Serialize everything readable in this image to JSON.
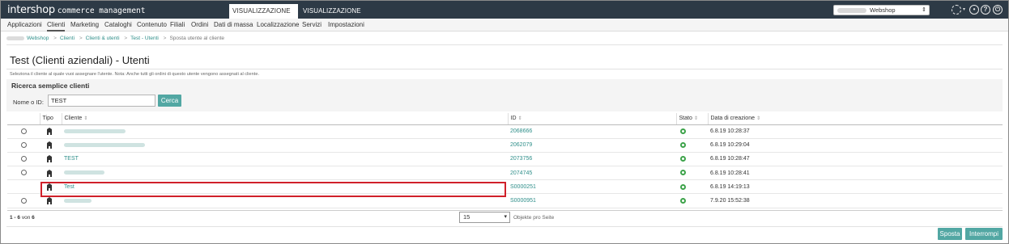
{
  "header": {
    "brand_main": "intershop",
    "brand_sub": "commerce management",
    "tab_data": "VISUALIZZAZIONE DATI",
    "tab_design": "VISUALIZZAZIONE DESIGN",
    "site_selector": "Webshop"
  },
  "nav": {
    "items": [
      "Applicazioni",
      "Clienti",
      "Marketing",
      "Cataloghi",
      "Contenuto",
      "Filiali",
      "Ordini",
      "Dati di massa",
      "Localizzazione",
      "Servizi",
      "Impostazioni"
    ],
    "active": "Clienti"
  },
  "breadcrumb": {
    "items": [
      "Webshop",
      "Clienti",
      "Clienti & utenti",
      "Test - Utenti",
      "Sposta utente al cliente"
    ]
  },
  "page": {
    "title": "Test (Clienti aziendali) - Utenti",
    "description": "Seleziona il cliente al quale vuoi assegnare l'utente. Nota: Anche tutti gli ordini di questo utente vengono assegnati al cliente."
  },
  "search": {
    "title": "Ricerca semplice clienti",
    "label": "Nome o ID:",
    "value": "TEST",
    "button": "Cerca"
  },
  "table": {
    "headers": {
      "type": "Tipo",
      "customer": "Cliente",
      "id": "ID",
      "status": "Stato",
      "created": "Data di creazione"
    },
    "rows": [
      {
        "name": "",
        "id": "2068666",
        "created": "6.8.19 10:28:37"
      },
      {
        "name": "",
        "id": "2062079",
        "created": "6.8.19 10:29:04"
      },
      {
        "name": "TEST",
        "id": "2073756",
        "created": "6.8.19 10:28:47"
      },
      {
        "name": "",
        "id": "2074745",
        "created": "6.8.19 10:28:41"
      },
      {
        "name": "Test",
        "id": "S0000251",
        "created": "6.8.19 14:19:13"
      },
      {
        "name": "",
        "id": "S0000951",
        "created": "7.9.20 15:52:38"
      }
    ]
  },
  "pagination": {
    "range": "1 - 6",
    "of": "von",
    "total": "6",
    "per_page": "15",
    "per_page_label": "Objekte pro Seite"
  },
  "actions": {
    "move": "Sposta",
    "abort": "Interrompi"
  },
  "colors": {
    "topbar": "#2d3a46",
    "accent": "#52a7a3",
    "link": "#2f8f8a",
    "status_ok": "#3da34a",
    "highlight": "#d0202a"
  }
}
